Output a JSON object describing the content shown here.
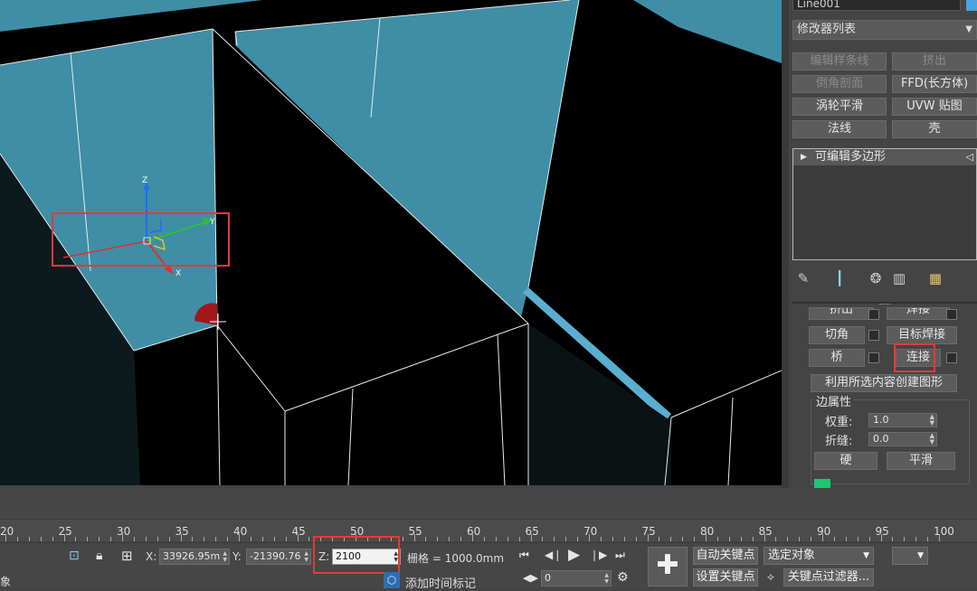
{
  "colors": {
    "wall_blue": "#3f8ea6",
    "viewport_black": "#000000",
    "highlight_red": "#e23a3a",
    "panel_bg": "#444444",
    "gizmo_z": "#1e6cff",
    "gizmo_y": "#2fbf2f",
    "gizmo_x": "#e03030"
  },
  "viewport": {
    "gizmo_axes": [
      "Z",
      "Y",
      "X"
    ]
  },
  "command_panel": {
    "object_name": "Line001",
    "modifier_list": "修改器列表",
    "modifier_buttons": [
      {
        "label": "编辑样条线",
        "enabled": false
      },
      {
        "label": "挤出",
        "enabled": false
      },
      {
        "label": "倒角剖面",
        "enabled": false
      },
      {
        "label": "FFD(长方体)",
        "enabled": true
      },
      {
        "label": "涡轮平滑",
        "enabled": true
      },
      {
        "label": "UVW 贴图",
        "enabled": true
      },
      {
        "label": "法线",
        "enabled": true
      },
      {
        "label": "壳",
        "enabled": true
      }
    ],
    "stack_item": "可编辑多边形",
    "edit_edges": {
      "extrude": "挤出",
      "weld": "焊接",
      "chamfer": "切角",
      "target_weld": "目标焊接",
      "bridge": "桥",
      "connect": "连接",
      "create_shape": "利用所选内容创建图形"
    },
    "edge_properties": {
      "title": "边属性",
      "weight_label": "权重:",
      "weight_value": "1.0",
      "crease_label": "折缝:",
      "crease_value": "0.0",
      "hard": "硬",
      "smooth": "平滑"
    }
  },
  "timeline": {
    "ticks": [
      "20",
      "25",
      "30",
      "35",
      "40",
      "45",
      "50",
      "55",
      "60",
      "65",
      "70",
      "75",
      "80",
      "85",
      "90",
      "95",
      "100"
    ]
  },
  "status_bar": {
    "left_text": "象",
    "x_label": "X:",
    "x_value": "33926.95m",
    "y_label": "Y:",
    "y_value": "-21390.76",
    "z_label": "Z:",
    "z_value": "2100",
    "grid_text": "栅格 = 1000.0mm",
    "add_time_tag": "添加时间标记",
    "frame_value": "0",
    "auto_key": "自动关键点",
    "set_key": "设置关键点",
    "selected_object": "选定对象",
    "key_filters": "关键点过滤器..."
  }
}
